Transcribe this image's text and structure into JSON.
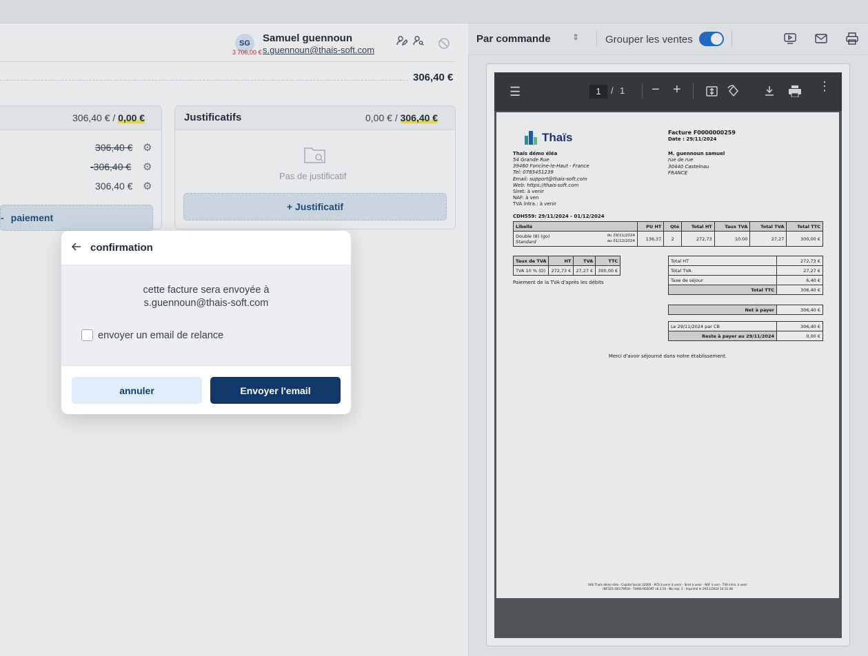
{
  "customer": {
    "initials": "SG",
    "name": "Samuel guennoun",
    "email": "s.guennoun@thais-soft.com",
    "balance": "3 706,00 €"
  },
  "summary": {
    "total": "306,40 €"
  },
  "payments": {
    "header_amount": "306,40 € / ",
    "header_highlight": "0,00 €",
    "rows": [
      "306,40 €",
      "-306,40 €",
      "306,40 €"
    ],
    "add_label": "paiement"
  },
  "justifs": {
    "title": "Justificatifs",
    "header_amount": "0,00 € / ",
    "header_highlight": "306,40 €",
    "empty": "Pas de justificatif",
    "add_label": "+ Justificatif"
  },
  "preview_toolbar": {
    "mode": "Par commande",
    "group_label": "Grouper les ventes",
    "group_enabled": true
  },
  "pdf": {
    "page_current": "1",
    "page_sep": "/",
    "page_total": "1",
    "logo": "Thaïs",
    "invoice_title": "Facture F0000000259",
    "invoice_date": "Date : 29/11/2024",
    "issuer": [
      "Thaïs démo éléa",
      "54 Grande Rue",
      "39460 Foncine-le-Haut - France",
      "Tel: 0785451239",
      "Email: support@thais-soft.com",
      "Web: https://thais-soft.com",
      "Siret: à venir",
      "NAF: à ven",
      "TVA intra.: à venir"
    ],
    "recipient": [
      "M. guennoun samuel",
      "rue de rue",
      "30440 Castelnau",
      "FRANCE"
    ],
    "stay": "CDH559: 29/11/2024 - 01/12/2024",
    "lines_headers": [
      "Libellé",
      "PU HT",
      "Qté",
      "Total HT",
      "Taux TVA",
      "Total TVA",
      "Total TTC"
    ],
    "line": {
      "label": "Double (8) (go)",
      "sub": "Standard",
      "from": "du 29/11/2024",
      "to": "au 01/12/2024",
      "pu": "136,37",
      "qty": "2",
      "ht": "272,73",
      "rate": "10.00",
      "tva": "27,27",
      "ttc": "300,00 €"
    },
    "vat_headers": [
      "Taux de TVA",
      "HT",
      "TVA",
      "TTC"
    ],
    "vat_row": [
      "TVA 10 % (D)",
      "272,73 €",
      "27,27 €",
      "300,00 €"
    ],
    "vat_note": "Paiement de la TVA d'après les débits",
    "totals": [
      [
        "Total HT",
        "272,73 €"
      ],
      [
        "Total TVA",
        "27,27 €"
      ],
      [
        "Taxe de séjour",
        "6,40 €"
      ],
      [
        "Total TTC",
        "306,40 €"
      ]
    ],
    "net": [
      "Net à payer",
      "306,40 €"
    ],
    "paid": [
      [
        "Le 29/11/2024 par CB",
        "306,40 €"
      ],
      [
        "Reste à payer au 29/11/2024",
        "0,00 €"
      ]
    ],
    "thanks": "Merci d'avoir séjourné dans notre établissement.",
    "footer1": "SAS Thaïs démo éléa - Capital Social 32000 - RCS à venir à venir - Siret à venir - NAF à ven - TVA intra. à venir",
    "footer2": "(NF525) B0179P2H - THAIS-RESORT v6.3.16 - Nb imp: 1 - Imprimé le 29/11/2024 14:11:48"
  },
  "modal": {
    "title": "confirmation",
    "message_line1": "cette facture sera envoyée à",
    "message_line2": "s.guennoun@thais-soft.com",
    "checkbox_label": "envoyer un email de relance",
    "checkbox_checked": false,
    "cancel": "annuler",
    "send": "Envoyer l'email"
  }
}
